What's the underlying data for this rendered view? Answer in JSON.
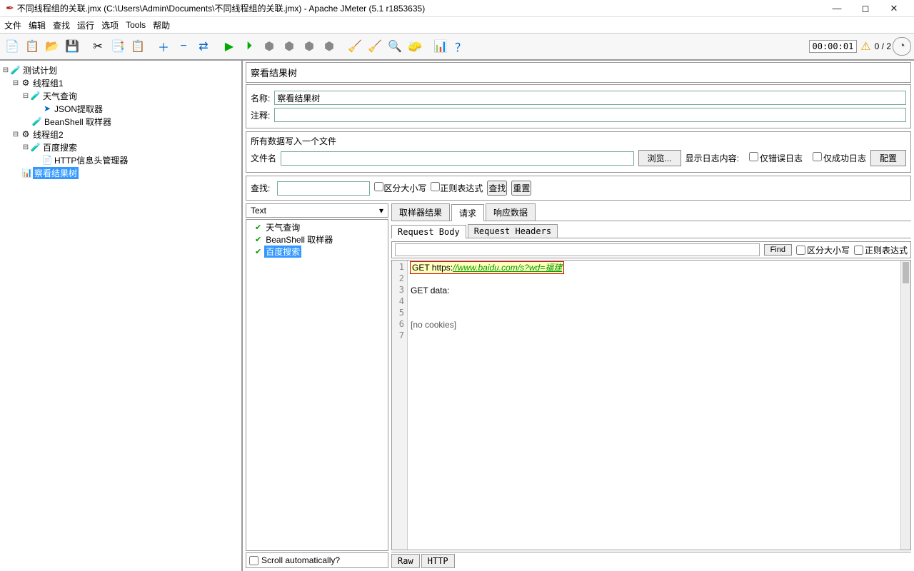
{
  "window": {
    "title": "不同线程组的关联.jmx (C:\\Users\\Admin\\Documents\\不同线程组的关联.jmx) - Apache JMeter (5.1 r1853635)"
  },
  "menu": {
    "file": "文件",
    "edit": "编辑",
    "search": "查找",
    "run": "运行",
    "options": "选项",
    "tools": "Tools",
    "help": "帮助"
  },
  "status": {
    "timer": "00:00:01",
    "count": "0 / 2"
  },
  "tree": {
    "root": "测试计划",
    "tg1": "线程组1",
    "weather": "天气查询",
    "json": "JSON提取器",
    "beanshell": "BeanShell 取样器",
    "tg2": "线程组2",
    "baidu": "百度搜索",
    "http": "HTTP信息头管理器",
    "viewtree": "察看结果树"
  },
  "panel": {
    "title": "察看结果树",
    "name_label": "名称:",
    "name_value": "察看结果树",
    "notes_label": "注释:",
    "file_section": "所有数据写入一个文件",
    "file_label": "文件名",
    "browse": "浏览...",
    "show_log": "显示日志内容:",
    "only_err": "仅错误日志",
    "only_ok": "仅成功日志",
    "configure": "配置"
  },
  "search": {
    "label": "查找:",
    "case": "区分大小写",
    "regex": "正则表达式",
    "find": "查找",
    "reset": "重置"
  },
  "dd": {
    "text": "Text"
  },
  "results": {
    "r1": "天气查询",
    "r2": "BeanShell 取样器",
    "r3": "百度搜索"
  },
  "scrollauto": "Scroll automatically?",
  "tabs1": {
    "sampler": "取样器结果",
    "request": "请求",
    "response": "响应数据"
  },
  "tabs2": {
    "body": "Request Body",
    "headers": "Request Headers"
  },
  "find": {
    "btn": "Find",
    "case": "区分大小写",
    "regex": "正则表达式"
  },
  "code": {
    "l1_prefix": "GET https:",
    "l1_url": "//www.baidu.com/s?wd=福建",
    "l3": "GET data:",
    "l6": "[no cookies]"
  },
  "btabs": {
    "raw": "Raw",
    "http": "HTTP"
  }
}
